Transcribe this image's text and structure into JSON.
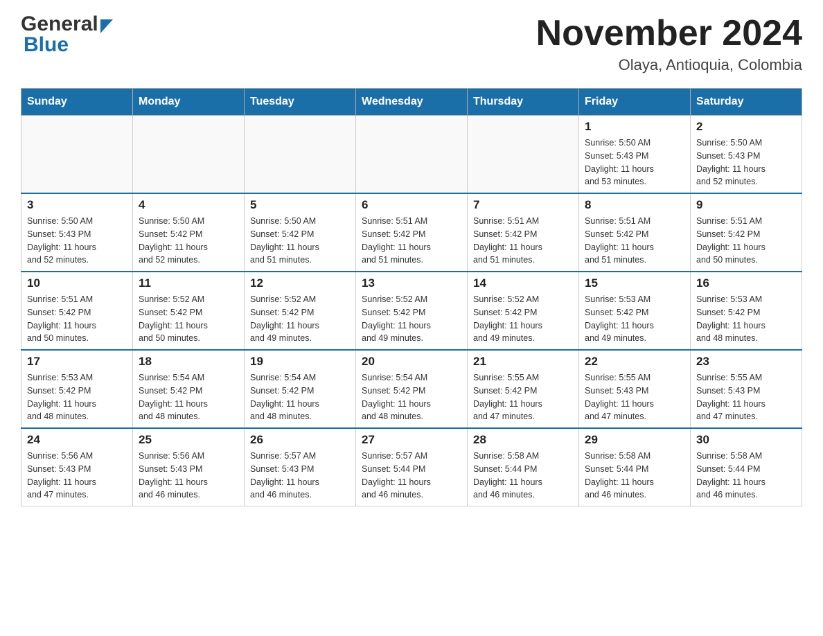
{
  "header": {
    "logo_general": "General",
    "logo_blue": "Blue",
    "month_title": "November 2024",
    "location": "Olaya, Antioquia, Colombia"
  },
  "weekdays": [
    "Sunday",
    "Monday",
    "Tuesday",
    "Wednesday",
    "Thursday",
    "Friday",
    "Saturday"
  ],
  "weeks": [
    {
      "days": [
        {
          "number": "",
          "info": ""
        },
        {
          "number": "",
          "info": ""
        },
        {
          "number": "",
          "info": ""
        },
        {
          "number": "",
          "info": ""
        },
        {
          "number": "",
          "info": ""
        },
        {
          "number": "1",
          "info": "Sunrise: 5:50 AM\nSunset: 5:43 PM\nDaylight: 11 hours\nand 53 minutes."
        },
        {
          "number": "2",
          "info": "Sunrise: 5:50 AM\nSunset: 5:43 PM\nDaylight: 11 hours\nand 52 minutes."
        }
      ]
    },
    {
      "days": [
        {
          "number": "3",
          "info": "Sunrise: 5:50 AM\nSunset: 5:43 PM\nDaylight: 11 hours\nand 52 minutes."
        },
        {
          "number": "4",
          "info": "Sunrise: 5:50 AM\nSunset: 5:42 PM\nDaylight: 11 hours\nand 52 minutes."
        },
        {
          "number": "5",
          "info": "Sunrise: 5:50 AM\nSunset: 5:42 PM\nDaylight: 11 hours\nand 51 minutes."
        },
        {
          "number": "6",
          "info": "Sunrise: 5:51 AM\nSunset: 5:42 PM\nDaylight: 11 hours\nand 51 minutes."
        },
        {
          "number": "7",
          "info": "Sunrise: 5:51 AM\nSunset: 5:42 PM\nDaylight: 11 hours\nand 51 minutes."
        },
        {
          "number": "8",
          "info": "Sunrise: 5:51 AM\nSunset: 5:42 PM\nDaylight: 11 hours\nand 51 minutes."
        },
        {
          "number": "9",
          "info": "Sunrise: 5:51 AM\nSunset: 5:42 PM\nDaylight: 11 hours\nand 50 minutes."
        }
      ]
    },
    {
      "days": [
        {
          "number": "10",
          "info": "Sunrise: 5:51 AM\nSunset: 5:42 PM\nDaylight: 11 hours\nand 50 minutes."
        },
        {
          "number": "11",
          "info": "Sunrise: 5:52 AM\nSunset: 5:42 PM\nDaylight: 11 hours\nand 50 minutes."
        },
        {
          "number": "12",
          "info": "Sunrise: 5:52 AM\nSunset: 5:42 PM\nDaylight: 11 hours\nand 49 minutes."
        },
        {
          "number": "13",
          "info": "Sunrise: 5:52 AM\nSunset: 5:42 PM\nDaylight: 11 hours\nand 49 minutes."
        },
        {
          "number": "14",
          "info": "Sunrise: 5:52 AM\nSunset: 5:42 PM\nDaylight: 11 hours\nand 49 minutes."
        },
        {
          "number": "15",
          "info": "Sunrise: 5:53 AM\nSunset: 5:42 PM\nDaylight: 11 hours\nand 49 minutes."
        },
        {
          "number": "16",
          "info": "Sunrise: 5:53 AM\nSunset: 5:42 PM\nDaylight: 11 hours\nand 48 minutes."
        }
      ]
    },
    {
      "days": [
        {
          "number": "17",
          "info": "Sunrise: 5:53 AM\nSunset: 5:42 PM\nDaylight: 11 hours\nand 48 minutes."
        },
        {
          "number": "18",
          "info": "Sunrise: 5:54 AM\nSunset: 5:42 PM\nDaylight: 11 hours\nand 48 minutes."
        },
        {
          "number": "19",
          "info": "Sunrise: 5:54 AM\nSunset: 5:42 PM\nDaylight: 11 hours\nand 48 minutes."
        },
        {
          "number": "20",
          "info": "Sunrise: 5:54 AM\nSunset: 5:42 PM\nDaylight: 11 hours\nand 48 minutes."
        },
        {
          "number": "21",
          "info": "Sunrise: 5:55 AM\nSunset: 5:42 PM\nDaylight: 11 hours\nand 47 minutes."
        },
        {
          "number": "22",
          "info": "Sunrise: 5:55 AM\nSunset: 5:43 PM\nDaylight: 11 hours\nand 47 minutes."
        },
        {
          "number": "23",
          "info": "Sunrise: 5:55 AM\nSunset: 5:43 PM\nDaylight: 11 hours\nand 47 minutes."
        }
      ]
    },
    {
      "days": [
        {
          "number": "24",
          "info": "Sunrise: 5:56 AM\nSunset: 5:43 PM\nDaylight: 11 hours\nand 47 minutes."
        },
        {
          "number": "25",
          "info": "Sunrise: 5:56 AM\nSunset: 5:43 PM\nDaylight: 11 hours\nand 46 minutes."
        },
        {
          "number": "26",
          "info": "Sunrise: 5:57 AM\nSunset: 5:43 PM\nDaylight: 11 hours\nand 46 minutes."
        },
        {
          "number": "27",
          "info": "Sunrise: 5:57 AM\nSunset: 5:44 PM\nDaylight: 11 hours\nand 46 minutes."
        },
        {
          "number": "28",
          "info": "Sunrise: 5:58 AM\nSunset: 5:44 PM\nDaylight: 11 hours\nand 46 minutes."
        },
        {
          "number": "29",
          "info": "Sunrise: 5:58 AM\nSunset: 5:44 PM\nDaylight: 11 hours\nand 46 minutes."
        },
        {
          "number": "30",
          "info": "Sunrise: 5:58 AM\nSunset: 5:44 PM\nDaylight: 11 hours\nand 46 minutes."
        }
      ]
    }
  ]
}
